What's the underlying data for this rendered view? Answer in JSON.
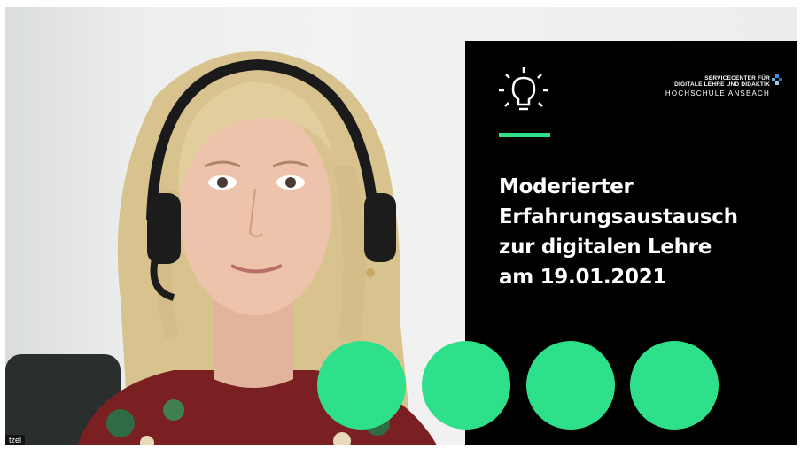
{
  "participant": {
    "name_label": "tzel"
  },
  "slide": {
    "logo": {
      "line1": "SERVICECENTER FÜR",
      "line2": "DIGITALE LEHRE UND DIDAKTIK",
      "line3": "HOCHSCHULE ANSBACH"
    },
    "title_lines": [
      "Moderierter",
      "Erfahrungsaustausch",
      "zur digitalen Lehre",
      "am 19.01.2021"
    ],
    "icons": [
      "lightbulb-icon"
    ],
    "colors": {
      "background": "#000000",
      "accent": "#2ee08a",
      "text": "#ffffff",
      "logo_mark": "#3d8fd6"
    }
  }
}
